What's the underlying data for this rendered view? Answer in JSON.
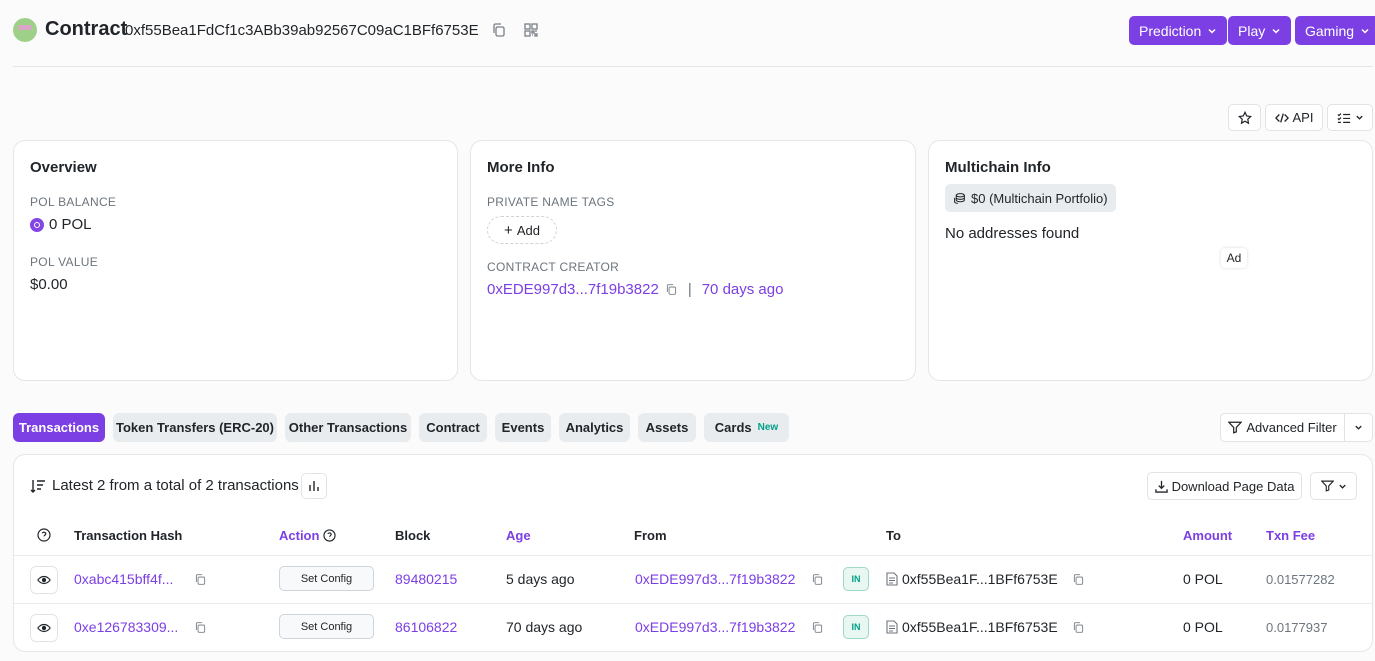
{
  "header": {
    "title": "Contract",
    "address": "0xf55Bea1FdCf1c3ABb39ab92567C09aC1BFf6753E",
    "buttons": [
      {
        "label": "Prediction"
      },
      {
        "label": "Play"
      },
      {
        "label": "Gaming"
      }
    ]
  },
  "toolbar": {
    "api_label": "API"
  },
  "overview": {
    "title": "Overview",
    "balance_label": "POL BALANCE",
    "balance_value": "0 POL",
    "value_label": "POL VALUE",
    "value_value": "$0.00"
  },
  "more_info": {
    "title": "More Info",
    "tags_label": "PRIVATE NAME TAGS",
    "add_label": "Add",
    "creator_label": "CONTRACT CREATOR",
    "creator_address": "0xEDE997d3...7f19b3822",
    "separator": "|",
    "creator_age": "70 days ago"
  },
  "multichain": {
    "title": "Multichain Info",
    "portfolio": "$0 (Multichain Portfolio)",
    "empty": "No addresses found",
    "ad": "Ad"
  },
  "tabs": [
    {
      "label": "Transactions"
    },
    {
      "label": "Token Transfers (ERC-20)"
    },
    {
      "label": "Other Transactions"
    },
    {
      "label": "Contract"
    },
    {
      "label": "Events"
    },
    {
      "label": "Analytics"
    },
    {
      "label": "Assets"
    },
    {
      "label": "Cards",
      "badge": "New"
    }
  ],
  "advanced_filter": "Advanced Filter",
  "table": {
    "summary": "Latest 2 from a total of 2 transactions",
    "download": "Download Page Data",
    "headers": {
      "hash": "Transaction Hash",
      "action": "Action",
      "block": "Block",
      "age": "Age",
      "from": "From",
      "to": "To",
      "amount": "Amount",
      "fee": "Txn Fee"
    },
    "rows": [
      {
        "hash": "0xabc415bff4f...",
        "action": "Set Config",
        "block": "89480215",
        "age": "5 days ago",
        "from": "0xEDE997d3...7f19b3822",
        "direction": "IN",
        "to": "0xf55Bea1F...1BFf6753E",
        "amount": "0 POL",
        "fee": "0.01577282"
      },
      {
        "hash": "0xe126783309...",
        "action": "Set Config",
        "block": "86106822",
        "age": "70 days ago",
        "from": "0xEDE997d3...7f19b3822",
        "direction": "IN",
        "to": "0xf55Bea1F...1BFf6753E",
        "amount": "0 POL",
        "fee": "0.0177937"
      }
    ]
  }
}
